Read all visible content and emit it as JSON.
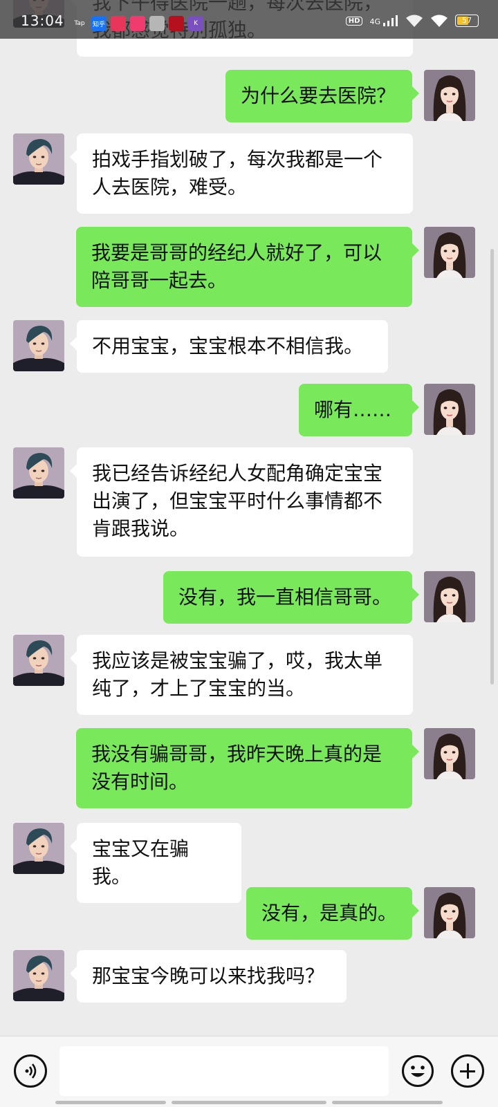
{
  "status_bar": {
    "time": "13:04",
    "apps": [
      {
        "name": "taptap-icon",
        "label": "Tap",
        "color": "transparent"
      },
      {
        "name": "zhihu-icon",
        "label": "知乎",
        "color": "#1772f6"
      },
      {
        "name": "heart-app-icon",
        "label": "",
        "color": "#e8365a"
      },
      {
        "name": "pink-app-icon",
        "label": "",
        "color": "#ef3b6e"
      },
      {
        "name": "game-app-icon",
        "label": "",
        "color": "#b6b6b6"
      },
      {
        "name": "red-app-icon",
        "label": "",
        "color": "#b4101e"
      },
      {
        "name": "purple-app-icon",
        "label": "K",
        "color": "#7a4fbf"
      }
    ],
    "hd": "HD",
    "network": "4G",
    "battery": "57",
    "battery_level": 0.57
  },
  "messages": [
    {
      "side": "in",
      "text": "我下午得医院一趟，每次去医院，我都感觉特别孤独。"
    },
    {
      "side": "out",
      "text": "为什么要去医院？"
    },
    {
      "side": "in",
      "text": "拍戏手指划破了，每次我都是一个人去医院，难受。"
    },
    {
      "side": "out",
      "text": "我要是哥哥的经纪人就好了，可以陪哥哥一起去。"
    },
    {
      "side": "in",
      "text": "不用宝宝，宝宝根本不相信我。"
    },
    {
      "side": "out",
      "text": "哪有……"
    },
    {
      "side": "in",
      "text": "我已经告诉经纪人女配角确定宝宝出演了，但宝宝平时什么事情都不肯跟我说。"
    },
    {
      "side": "out",
      "text": "没有，我一直相信哥哥。"
    },
    {
      "side": "in",
      "text": "我应该是被宝宝骗了，哎，我太单纯了，才上了宝宝的当。"
    },
    {
      "side": "out",
      "text": "我没有骗哥哥，我昨天晚上真的是没有时间。"
    },
    {
      "side": "in",
      "text": "宝宝又在骗我。"
    },
    {
      "side": "out",
      "text": "没有，是真的。"
    },
    {
      "side": "in",
      "text": "那宝宝今晚可以来找我吗？"
    }
  ],
  "input_bar": {
    "text_value": "",
    "icons": [
      "voice-icon",
      "emoji-icon",
      "plus-icon"
    ]
  },
  "colors": {
    "background": "#ececec",
    "outgoing_bubble": "#79e85b",
    "incoming_bubble": "#ffffff"
  }
}
